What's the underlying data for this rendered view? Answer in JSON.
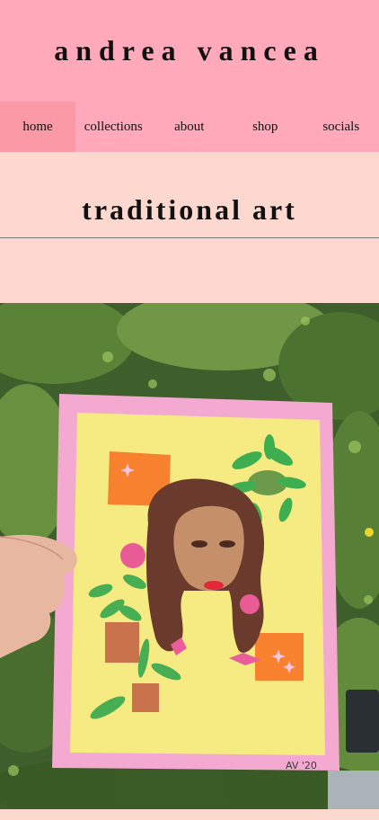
{
  "site": {
    "title": "andrea vancea"
  },
  "nav": {
    "items": [
      {
        "label": "home",
        "active": true
      },
      {
        "label": "collections",
        "active": false
      },
      {
        "label": "about",
        "active": false
      },
      {
        "label": "shop",
        "active": false
      },
      {
        "label": "socials",
        "active": false
      }
    ]
  },
  "page": {
    "section_title": "traditional art"
  },
  "artwork": {
    "signature": "AV '20"
  },
  "colors": {
    "header_bg": "#ffa9bb",
    "nav_active_bg": "#fb9aa6",
    "page_bg": "#fcd8cf"
  }
}
